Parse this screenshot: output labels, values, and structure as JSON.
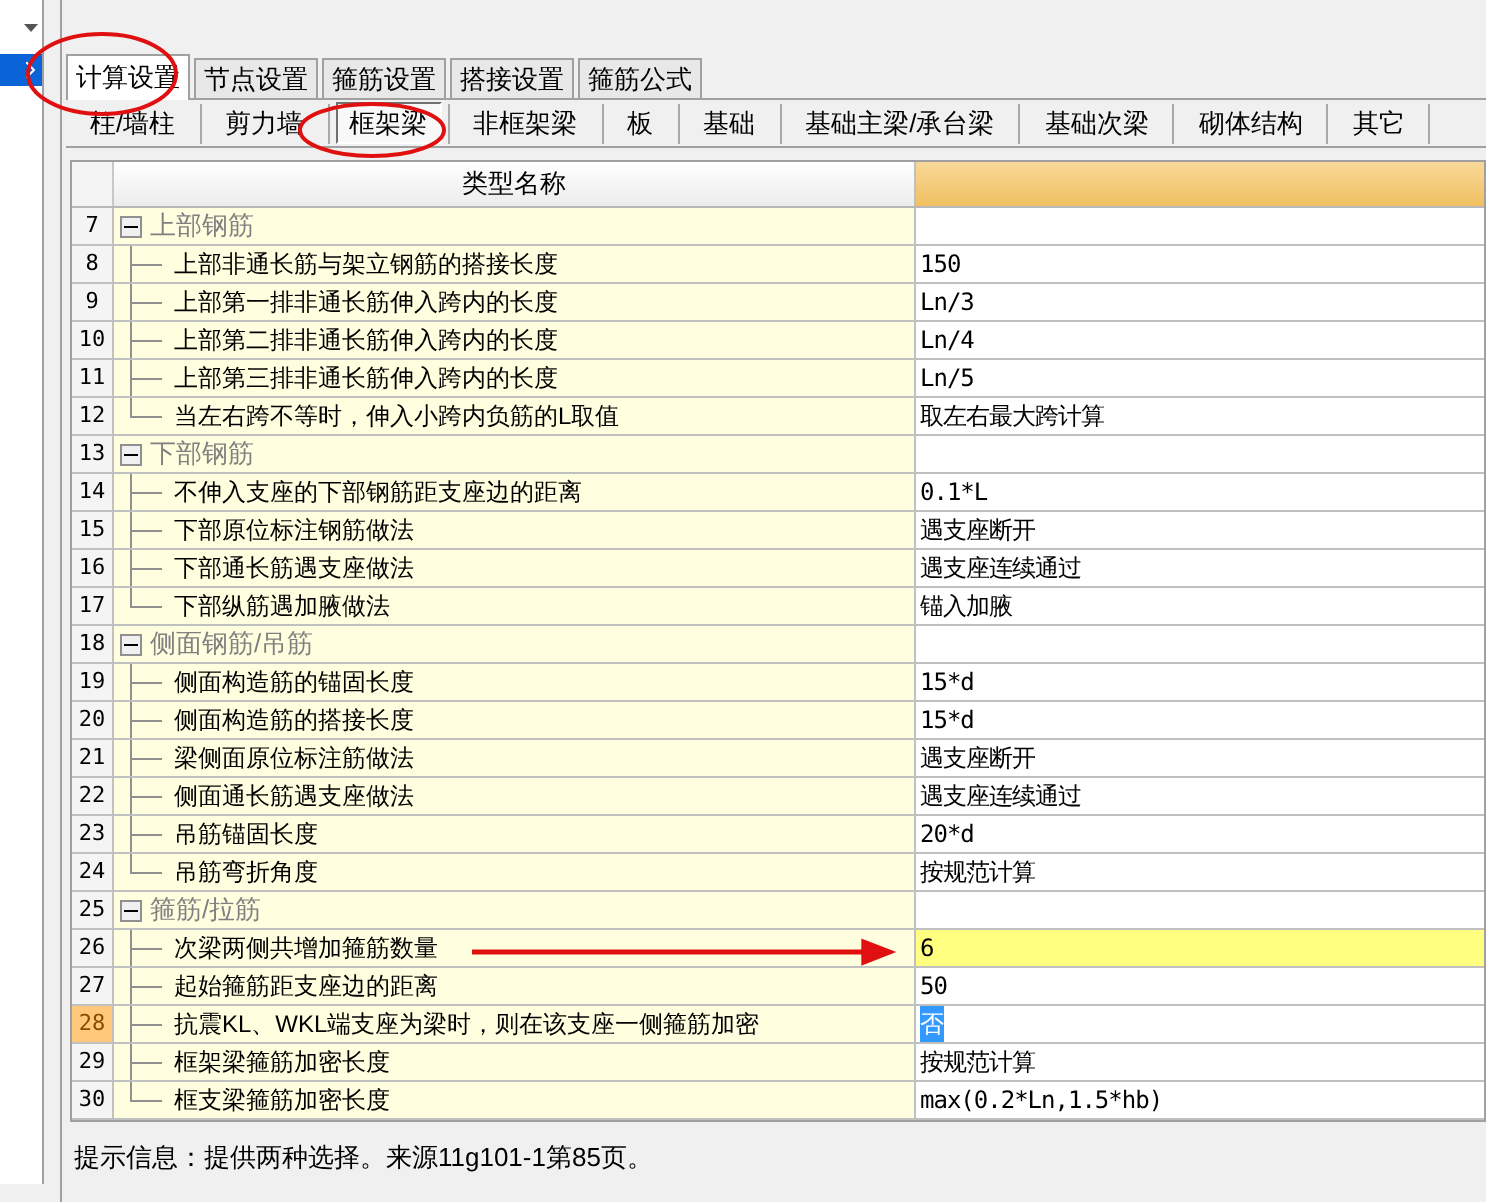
{
  "tabs": [
    {
      "label": "计算设置",
      "selected": true
    },
    {
      "label": "节点设置",
      "selected": false
    },
    {
      "label": "箍筋设置",
      "selected": false
    },
    {
      "label": "搭接设置",
      "selected": false
    },
    {
      "label": "箍筋公式",
      "selected": false
    }
  ],
  "sub_tabs": [
    {
      "label": "柱/墙柱",
      "selected": false
    },
    {
      "label": "剪力墙",
      "selected": false
    },
    {
      "label": "框架梁",
      "selected": true
    },
    {
      "label": "非框架梁",
      "selected": false
    },
    {
      "label": "板",
      "selected": false
    },
    {
      "label": "基础",
      "selected": false
    },
    {
      "label": "基础主梁/承台梁",
      "selected": false
    },
    {
      "label": "基础次梁",
      "selected": false
    },
    {
      "label": "砌体结构",
      "selected": false
    },
    {
      "label": "其它",
      "selected": false
    }
  ],
  "table": {
    "columns": [
      "类型名称"
    ],
    "rows": [
      {
        "number": "7",
        "name": "上部钢筋",
        "expanded": true,
        "selected": false,
        "children": [
          {
            "number": "8",
            "name": "上部非通长筋与架立钢筋的搭接长度",
            "value": "150",
            "selected": false,
            "highlighted": false
          },
          {
            "number": "9",
            "name": "上部第一排非通长筋伸入跨内的长度",
            "value": "Ln/3",
            "selected": false,
            "highlighted": false
          },
          {
            "number": "10",
            "name": "上部第二排非通长筋伸入跨内的长度",
            "value": "Ln/4",
            "selected": false,
            "highlighted": false
          },
          {
            "number": "11",
            "name": "上部第三排非通长筋伸入跨内的长度",
            "value": "Ln/5",
            "selected": false,
            "highlighted": false
          },
          {
            "number": "12",
            "name": "当左右跨不等时，伸入小跨内负筋的L取值",
            "value": "取左右最大跨计算",
            "selected": false,
            "highlighted": false
          }
        ]
      },
      {
        "number": "13",
        "name": "下部钢筋",
        "expanded": true,
        "selected": false,
        "children": [
          {
            "number": "14",
            "name": "不伸入支座的下部钢筋距支座边的距离",
            "value": "0.1*L",
            "selected": false,
            "highlighted": false
          },
          {
            "number": "15",
            "name": "下部原位标注钢筋做法",
            "value": "遇支座断开",
            "selected": false,
            "highlighted": false
          },
          {
            "number": "16",
            "name": "下部通长筋遇支座做法",
            "value": "遇支座连续通过",
            "selected": false,
            "highlighted": false
          },
          {
            "number": "17",
            "name": "下部纵筋遇加腋做法",
            "value": "锚入加腋",
            "selected": false,
            "highlighted": false
          }
        ]
      },
      {
        "number": "18",
        "name": "侧面钢筋/吊筋",
        "expanded": true,
        "selected": false,
        "children": [
          {
            "number": "19",
            "name": "侧面构造筋的锚固长度",
            "value": "15*d",
            "selected": false,
            "highlighted": false
          },
          {
            "number": "20",
            "name": "侧面构造筋的搭接长度",
            "value": "15*d",
            "selected": false,
            "highlighted": false
          },
          {
            "number": "21",
            "name": "梁侧面原位标注筋做法",
            "value": "遇支座断开",
            "selected": false,
            "highlighted": false
          },
          {
            "number": "22",
            "name": "侧面通长筋遇支座做法",
            "value": "遇支座连续通过",
            "selected": false,
            "highlighted": false
          },
          {
            "number": "23",
            "name": "吊筋锚固长度",
            "value": "20*d",
            "selected": false,
            "highlighted": false
          },
          {
            "number": "24",
            "name": "吊筋弯折角度",
            "value": "按规范计算",
            "selected": false,
            "highlighted": false
          }
        ]
      },
      {
        "number": "25",
        "name": "箍筋/拉筋",
        "expanded": true,
        "selected": false,
        "children": [
          {
            "number": "26",
            "name": "次梁两侧共增加箍筋数量",
            "value": "6",
            "selected": false,
            "highlighted": true
          },
          {
            "number": "27",
            "name": "起始箍筋距支座边的距离",
            "value": "50",
            "selected": false,
            "highlighted": false
          },
          {
            "number": "28",
            "name": "抗震KL、WKL端支座为梁时，则在该支座一侧箍筋加密",
            "value": "否",
            "selected": true,
            "highlighted": false
          },
          {
            "number": "29",
            "name": "框架梁箍筋加密长度",
            "value": "按规范计算",
            "selected": false,
            "highlighted": false
          },
          {
            "number": "30",
            "name": "框支梁箍筋加密长度",
            "value": "max(0.2*Ln,1.5*hb)",
            "selected": false,
            "highlighted": false
          }
        ]
      }
    ]
  },
  "hint": "提示信息：提供两种选择。来源11g101-1第85页。"
}
